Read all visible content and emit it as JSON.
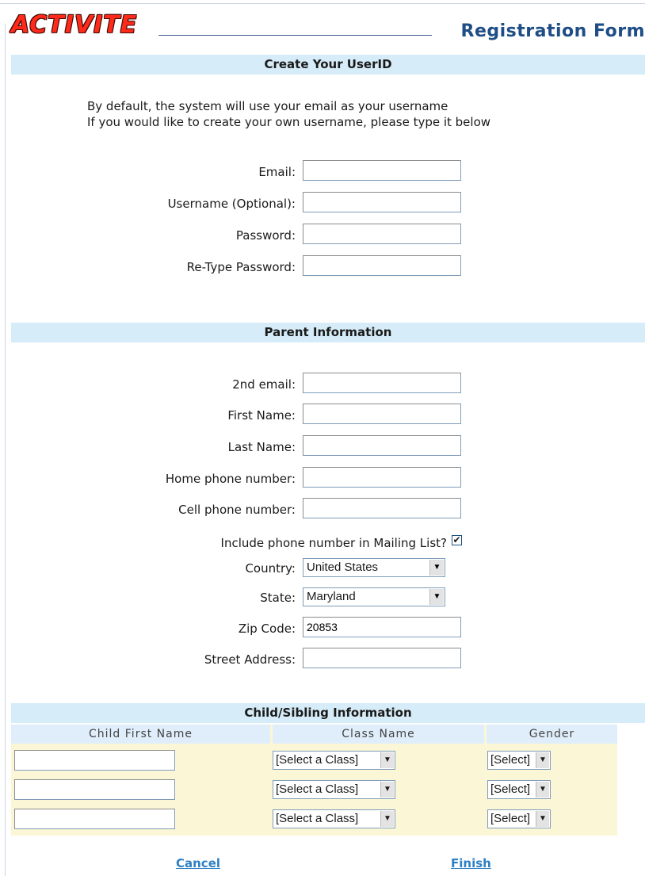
{
  "header": {
    "logo_text": "ACTIVITE",
    "title": "Registration Form"
  },
  "sections": {
    "userid": "Create Your UserID",
    "parent": "Parent Information",
    "child": "Child/Sibling Information"
  },
  "intro": {
    "line1": "By default, the system will use your email as your username",
    "line2": "If you would like to create your own username, please type it below"
  },
  "userid_fields": [
    {
      "label": "Email:",
      "value": ""
    },
    {
      "label": "Username (Optional):",
      "value": ""
    },
    {
      "label": "Password:",
      "value": ""
    },
    {
      "label": "Re-Type Password:",
      "value": ""
    }
  ],
  "parent_fields": {
    "email2": {
      "label": "2nd email:",
      "value": ""
    },
    "first_name": {
      "label": "First Name:",
      "value": ""
    },
    "last_name": {
      "label": "Last Name:",
      "value": ""
    },
    "home_phone": {
      "label": "Home phone number:",
      "value": ""
    },
    "cell_phone": {
      "label": "Cell phone number:",
      "value": ""
    },
    "mailing_list": {
      "label": "Include phone number in Mailing List?",
      "checked": true,
      "mark": "✔"
    },
    "country": {
      "label": "Country:",
      "value": "United States"
    },
    "state": {
      "label": "State:",
      "value": "Maryland"
    },
    "zip": {
      "label": "Zip Code:",
      "value": "20853"
    },
    "street": {
      "label": "Street Address:",
      "value": ""
    }
  },
  "child_table": {
    "headers": [
      "Child First Name",
      "Class Name",
      "Gender"
    ],
    "rows": [
      {
        "first_name": "",
        "class": "[Select a Class]",
        "gender": "[Select]"
      },
      {
        "first_name": "",
        "class": "[Select a Class]",
        "gender": "[Select]"
      },
      {
        "first_name": "",
        "class": "[Select a Class]",
        "gender": "[Select]"
      }
    ]
  },
  "actions": {
    "cancel": "Cancel",
    "finish": "Finish"
  },
  "icons": {
    "dropdown_arrow": "▼"
  },
  "colors": {
    "section_bar": "#d6ecf8",
    "title": "#1f4d86",
    "link": "#2f80c4",
    "table_bg": "#fbf7d6",
    "logo": "#ff2a1a"
  }
}
